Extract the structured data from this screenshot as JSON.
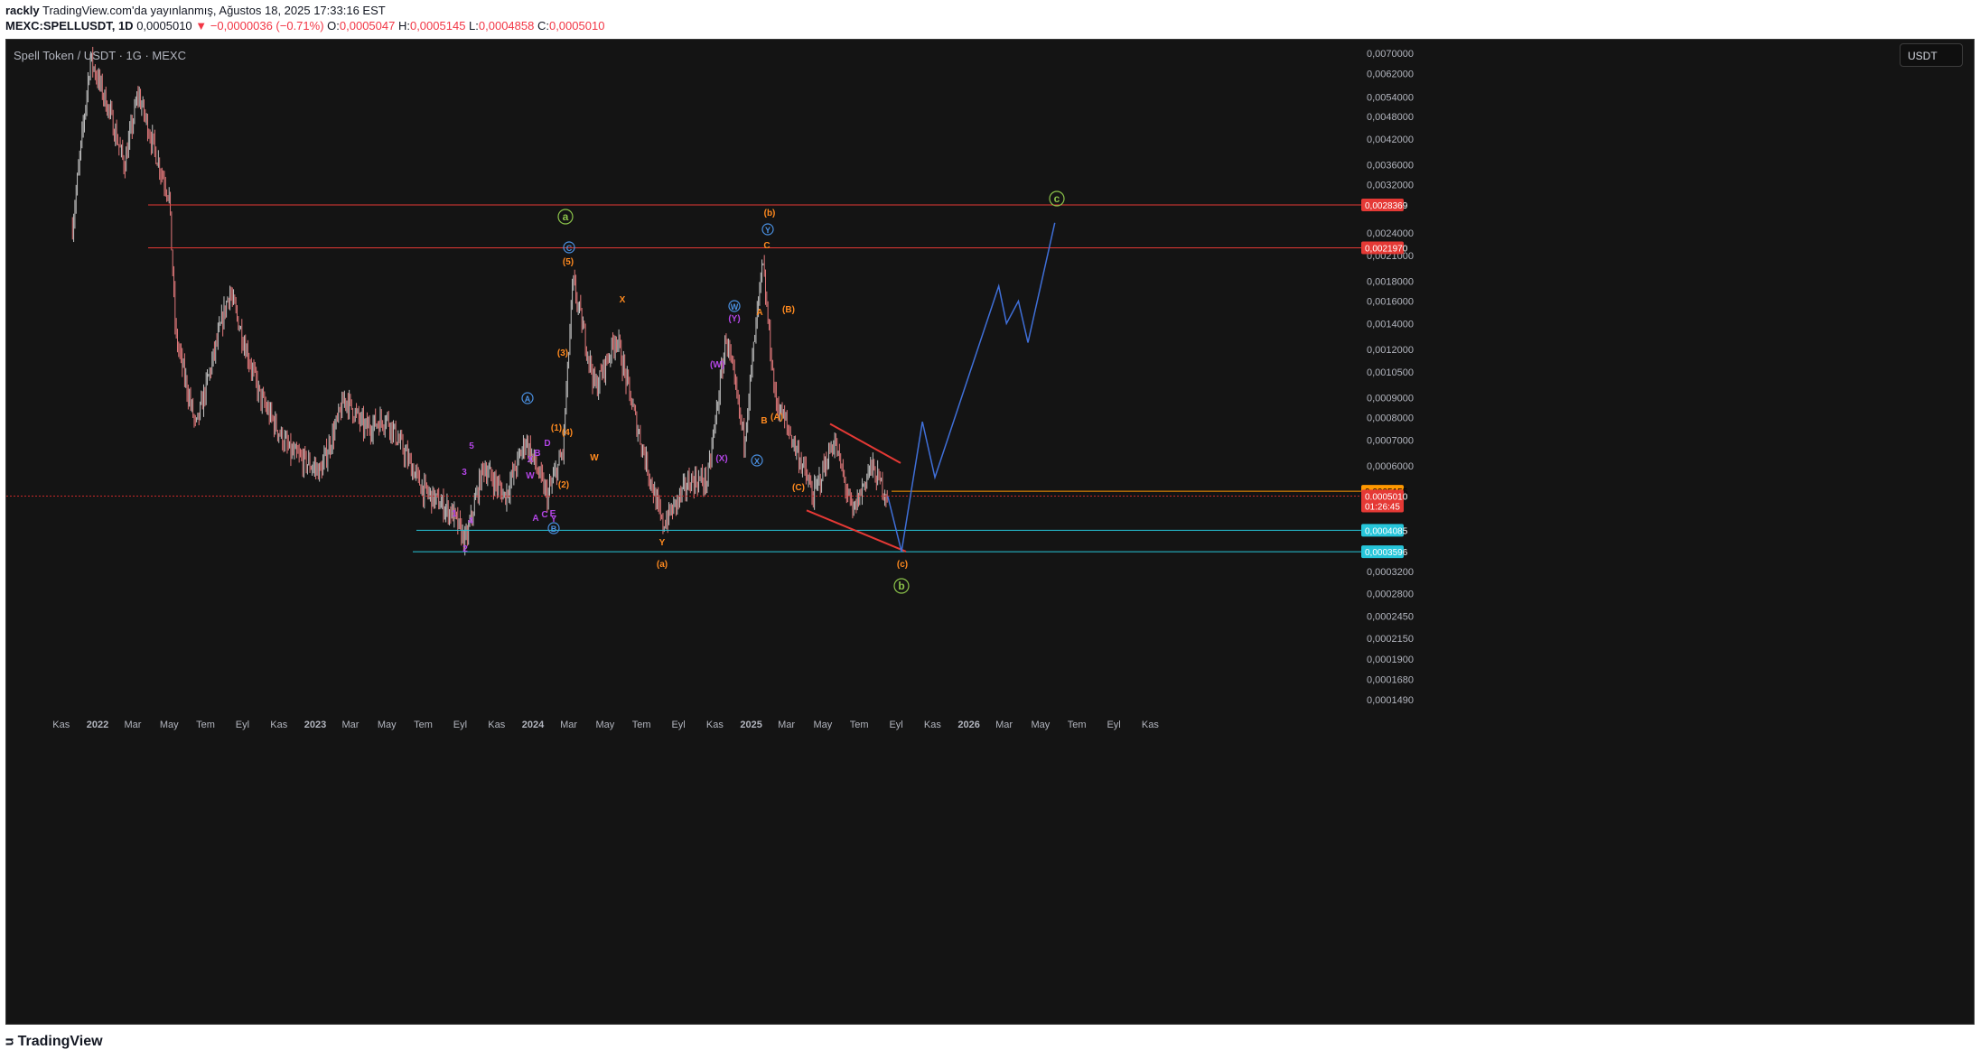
{
  "header": {
    "user": "rackly",
    "published": "TradingView.com'da yayınlanmış, Ağustos 18, 2025 17:33:16 EST",
    "symbol": "MEXC:SPELLUSDT, 1D",
    "last": "0,0005010",
    "change": "▼ −0,0000036 (−0.71%)",
    "o_label": "O:",
    "o_value": "0,0005047",
    "h_label": "H:",
    "h_value": "0,0005145",
    "l_label": "L:",
    "l_value": "0,0004858",
    "c_label": "C:",
    "c_value": "0,0005010"
  },
  "chart_title": "Spell Token / USDT · 1G · MEXC",
  "currency_button": "USDT",
  "footer": {
    "logo": "TradingView"
  },
  "colors": {
    "background": "#141414",
    "candle_up": "#c2c2c2",
    "candle_down": "#e0787a",
    "red_line": "#e53935",
    "cyan_line": "#26c6da",
    "orange_line": "#ff9800",
    "projection": "#3f6fd8",
    "label_green": "#8bc34a",
    "label_orange": "#ff8a1f",
    "label_purple": "#b345e6",
    "label_blue": "#4a90e2"
  },
  "chart_data": {
    "type": "candlestick",
    "y_scale": "log",
    "y_ticks": [
      "0,0070000",
      "0,0062000",
      "0,0054000",
      "0,0048000",
      "0,0042000",
      "0,0036000",
      "0,0032000",
      "0,0024000",
      "0,0021000",
      "0,0018000",
      "0,0016000",
      "0,0014000",
      "0,0012000",
      "0,0010500",
      "0,0009000",
      "0,0008000",
      "0,0007000",
      "0,0006000",
      "0,0003200",
      "0,0002800",
      "0,0002450",
      "0,0002150",
      "0,0001900",
      "0,0001680",
      "0,0001490"
    ],
    "x_ticks": [
      "Kas",
      "2022",
      "Mar",
      "May",
      "Tem",
      "Eyl",
      "Kas",
      "2023",
      "Mar",
      "May",
      "Tem",
      "Eyl",
      "Kas",
      "2024",
      "Mar",
      "May",
      "Tem",
      "Eyl",
      "Kas",
      "2025",
      "Mar",
      "May",
      "Tem",
      "Eyl",
      "Kas",
      "2026",
      "Mar",
      "May",
      "Tem",
      "Eyl",
      "Kas"
    ],
    "price_badges": [
      {
        "text": "0,0028369",
        "style": "red"
      },
      {
        "text": "0,0021970",
        "style": "red"
      },
      {
        "text": "0,0005155",
        "style": "orange"
      },
      {
        "text": "0,0005010",
        "style": "red"
      },
      {
        "text": "01:26:45",
        "style": "red"
      },
      {
        "text": "0,0004085",
        "style": "cyan"
      },
      {
        "text": "0,0003596",
        "style": "cyan"
      }
    ],
    "wave_labels": [
      {
        "text": "a",
        "circled": true,
        "color": "green"
      },
      {
        "text": "b",
        "circled": true,
        "color": "green"
      },
      {
        "text": "c",
        "circled": true,
        "color": "green"
      },
      {
        "text": "(b)",
        "color": "orange"
      },
      {
        "text": "(a)",
        "color": "orange"
      },
      {
        "text": "(c)",
        "color": "orange"
      },
      {
        "text": "C",
        "circled": true,
        "color": "blue"
      },
      {
        "text": "Y",
        "circled": true,
        "color": "blue"
      },
      {
        "text": "W",
        "circled": true,
        "color": "blue"
      },
      {
        "text": "X",
        "circled": true,
        "color": "blue"
      },
      {
        "text": "A",
        "circled": true,
        "color": "blue"
      },
      {
        "text": "B",
        "circled": true,
        "color": "blue"
      },
      {
        "text": "(5)",
        "color": "orange"
      },
      {
        "text": "(4)",
        "color": "orange"
      },
      {
        "text": "(3)",
        "color": "orange"
      },
      {
        "text": "(2)",
        "color": "orange"
      },
      {
        "text": "(1)",
        "color": "orange"
      },
      {
        "text": "(B)",
        "color": "orange"
      },
      {
        "text": "(A)",
        "color": "orange"
      },
      {
        "text": "(C)",
        "color": "orange"
      },
      {
        "text": "(W)",
        "color": "purple"
      },
      {
        "text": "(X)",
        "color": "purple"
      },
      {
        "text": "(Y)",
        "color": "purple"
      },
      {
        "text": "X",
        "color": "orange"
      },
      {
        "text": "W",
        "color": "orange"
      },
      {
        "text": "Y",
        "color": "orange"
      },
      {
        "text": "A",
        "color": "orange"
      },
      {
        "text": "B",
        "color": "orange"
      },
      {
        "text": "C",
        "color": "orange"
      },
      {
        "text": "1",
        "color": "purple"
      },
      {
        "text": "2",
        "color": "purple"
      },
      {
        "text": "3",
        "color": "purple"
      },
      {
        "text": "4",
        "color": "purple"
      },
      {
        "text": "5",
        "color": "purple"
      },
      {
        "text": "A",
        "color": "purple"
      },
      {
        "text": "B",
        "color": "purple"
      },
      {
        "text": "C",
        "color": "purple"
      },
      {
        "text": "D",
        "color": "purple"
      },
      {
        "text": "E",
        "color": "purple"
      },
      {
        "text": "W",
        "color": "purple"
      },
      {
        "text": "X",
        "color": "purple"
      },
      {
        "text": "Y",
        "color": "purple"
      }
    ],
    "projection_path": [
      {
        "date": "2025-08-18",
        "price": 0.0005
      },
      {
        "date": "2025-09-10",
        "price": 0.00036
      },
      {
        "date": "2025-10-15",
        "price": 0.00078
      },
      {
        "date": "2025-11-05",
        "price": 0.00056
      },
      {
        "date": "2026-02-20",
        "price": 0.00175
      },
      {
        "date": "2026-03-05",
        "price": 0.0014
      },
      {
        "date": "2026-03-25",
        "price": 0.0016
      },
      {
        "date": "2026-04-10",
        "price": 0.00125
      },
      {
        "date": "2026-05-25",
        "price": 0.00255
      }
    ]
  }
}
